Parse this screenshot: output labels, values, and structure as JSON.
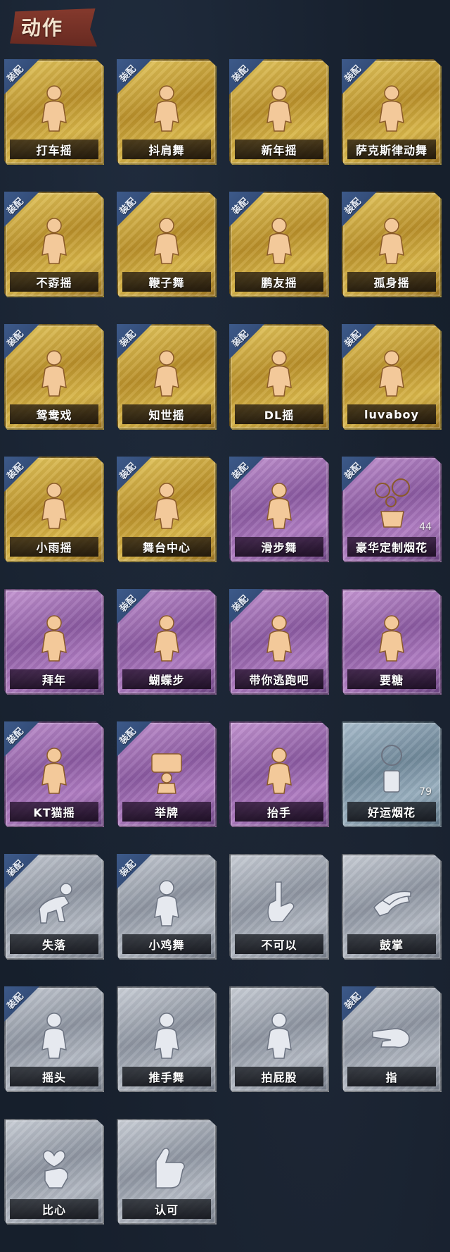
{
  "section": {
    "title": "动作"
  },
  "equip_badge_text": "装配",
  "tile_colors": {
    "gold": "#d4b44a",
    "purple": "#a774b8",
    "gray": "#a6acb6",
    "blue": "#7f97a8"
  },
  "cards": [
    {
      "label": "打车摇",
      "tier": "gold",
      "equipped": true,
      "icon": "dancer-figure-icon"
    },
    {
      "label": "抖肩舞",
      "tier": "gold",
      "equipped": true,
      "icon": "dancer-figure-icon"
    },
    {
      "label": "新年摇",
      "tier": "gold",
      "equipped": true,
      "icon": "dancer-figure-icon"
    },
    {
      "label": "萨克斯律动舞",
      "tier": "gold",
      "equipped": true,
      "icon": "sunglasses-dancer-icon"
    },
    {
      "label": "不孬摇",
      "tier": "gold",
      "equipped": true,
      "icon": "dancer-figure-icon"
    },
    {
      "label": "鞭子舞",
      "tier": "gold",
      "equipped": true,
      "icon": "dancer-figure-icon"
    },
    {
      "label": "鹏友摇",
      "tier": "gold",
      "equipped": true,
      "icon": "dancer-figure-icon"
    },
    {
      "label": "孤身摇",
      "tier": "gold",
      "equipped": true,
      "icon": "dancer-figure-icon"
    },
    {
      "label": "鸳鸯戏",
      "tier": "gold",
      "equipped": true,
      "icon": "dancer-figure-icon"
    },
    {
      "label": "知世摇",
      "tier": "gold",
      "equipped": true,
      "icon": "dancer-figure-icon"
    },
    {
      "label": "DL摇",
      "tier": "gold",
      "equipped": true,
      "icon": "dancer-figure-icon"
    },
    {
      "label": "luvaboy",
      "tier": "gold",
      "equipped": true,
      "icon": "dancer-figure-icon"
    },
    {
      "label": "小雨摇",
      "tier": "gold",
      "equipped": true,
      "icon": "dancer-figure-icon"
    },
    {
      "label": "舞台中心",
      "tier": "gold",
      "equipped": true,
      "icon": "dancer-figure-icon"
    },
    {
      "label": "滑步舞",
      "tier": "purple",
      "equipped": true,
      "icon": "dancer-figure-icon"
    },
    {
      "label": "豪华定制烟花",
      "tier": "purple",
      "equipped": true,
      "icon": "firework-box-icon",
      "count": "44"
    },
    {
      "label": "拜年",
      "tier": "purple",
      "equipped": false,
      "icon": "bowing-figure-icon"
    },
    {
      "label": "蝴蝶步",
      "tier": "purple",
      "equipped": true,
      "icon": "dancer-figure-icon"
    },
    {
      "label": "带你逃跑吧",
      "tier": "purple",
      "equipped": true,
      "icon": "dancer-figure-icon"
    },
    {
      "label": "要糖",
      "tier": "purple",
      "equipped": false,
      "icon": "reaching-figure-icon"
    },
    {
      "label": "KT猫摇",
      "tier": "purple",
      "equipped": true,
      "icon": "dancer-figure-icon"
    },
    {
      "label": "举牌",
      "tier": "purple",
      "equipped": true,
      "icon": "sign-holding-figure-icon"
    },
    {
      "label": "抬手",
      "tier": "purple",
      "equipped": false,
      "icon": "raising-hand-figure-icon"
    },
    {
      "label": "好运烟花",
      "tier": "blue",
      "equipped": false,
      "icon": "firework-can-icon",
      "count": "79"
    },
    {
      "label": "失落",
      "tier": "gray",
      "equipped": true,
      "icon": "crawling-figure-icon"
    },
    {
      "label": "小鸡舞",
      "tier": "gray",
      "equipped": true,
      "icon": "dancer-figure-icon"
    },
    {
      "label": "不可以",
      "tier": "gray",
      "equipped": false,
      "icon": "finger-wag-icon"
    },
    {
      "label": "鼓掌",
      "tier": "gray",
      "equipped": false,
      "icon": "clapping-hands-icon"
    },
    {
      "label": "摇头",
      "tier": "gray",
      "equipped": true,
      "icon": "dancer-figure-icon"
    },
    {
      "label": "推手舞",
      "tier": "gray",
      "equipped": false,
      "icon": "dancer-figure-icon"
    },
    {
      "label": "拍屁股",
      "tier": "gray",
      "equipped": false,
      "icon": "dancer-figure-icon"
    },
    {
      "label": "指",
      "tier": "gray",
      "equipped": true,
      "icon": "pointing-hand-icon"
    },
    {
      "label": "比心",
      "tier": "gray",
      "equipped": false,
      "icon": "finger-heart-icon"
    },
    {
      "label": "认可",
      "tier": "gray",
      "equipped": false,
      "icon": "thumbs-up-icon"
    }
  ]
}
